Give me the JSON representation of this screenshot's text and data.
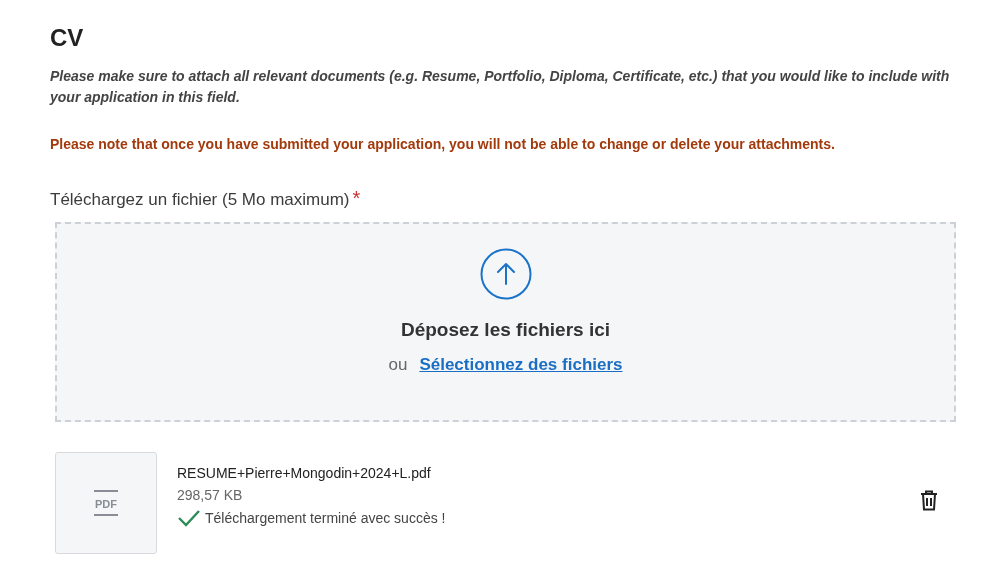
{
  "section": {
    "title": "CV",
    "instructions": "Please make sure to attach all relevant documents (e.g. Resume, Portfolio, Diploma, Certificate, etc.) that you would like to include with your application in this field.",
    "warning": "Please note that once you have submitted your application, you will not be able to change or delete your attachments."
  },
  "upload": {
    "label": "Téléchargez un fichier (5 Mo maximum)",
    "required_mark": "*",
    "drop_text": "Déposez les fichiers ici",
    "or_text": "ou",
    "select_link": "Sélectionnez des fichiers"
  },
  "files": [
    {
      "type_label": "PDF",
      "name": "RESUME+Pierre+Mongodin+2024+L.pdf",
      "size": "298,57 KB",
      "status": "Téléchargement terminé avec succès !",
      "kind": "success"
    }
  ]
}
